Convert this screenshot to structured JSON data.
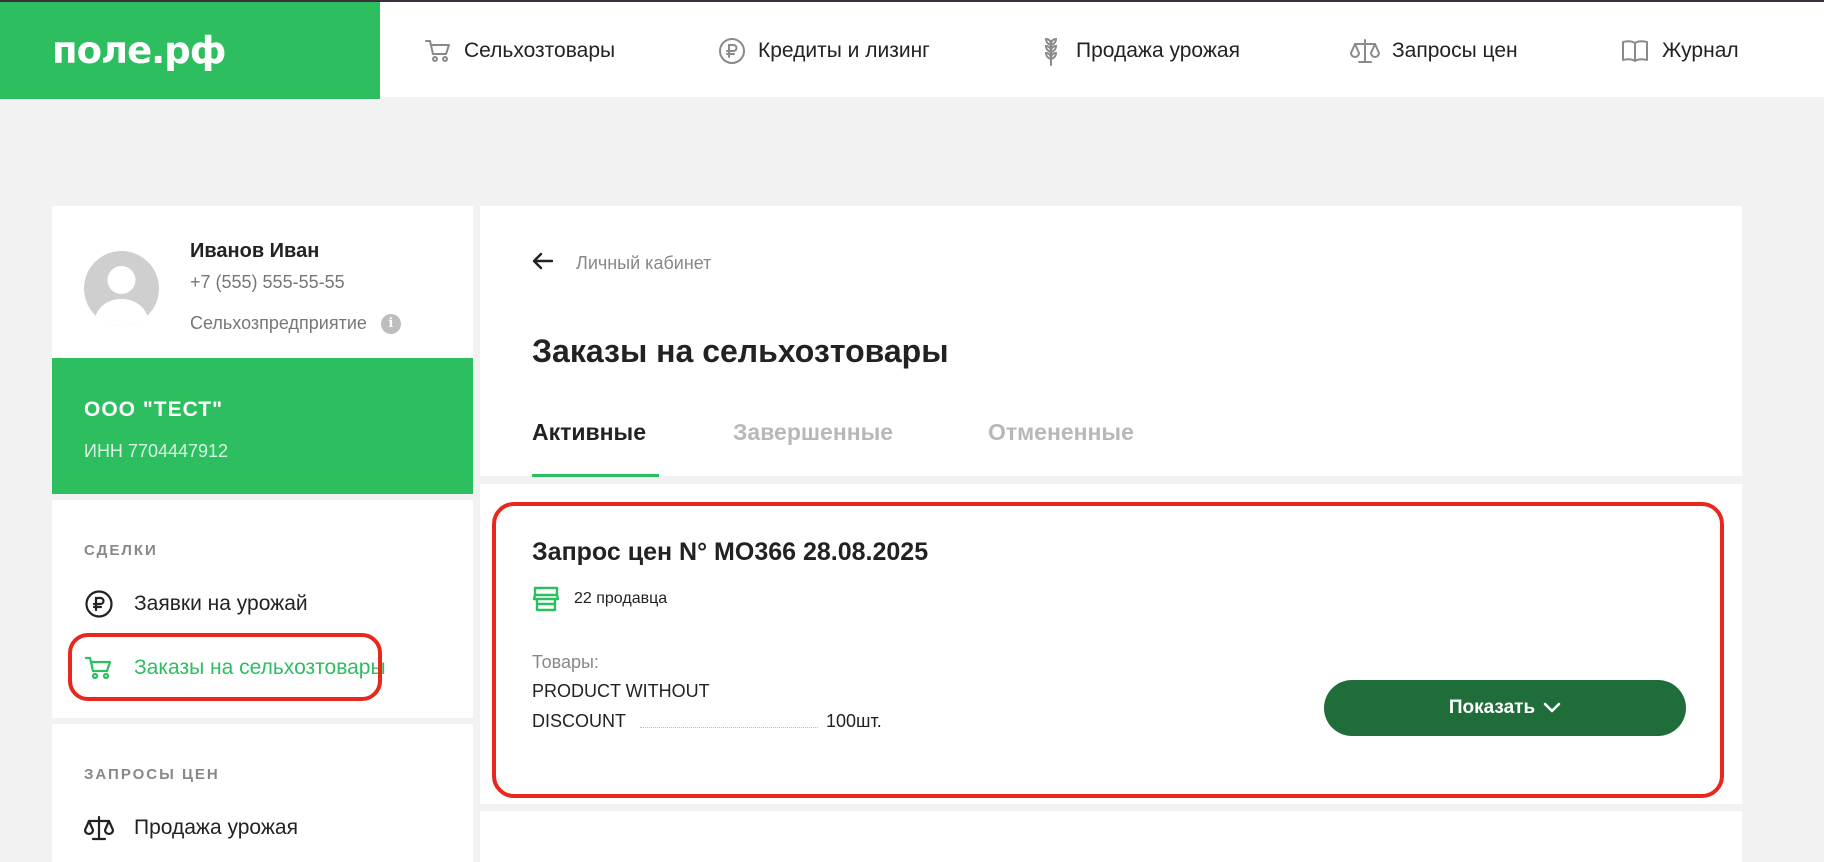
{
  "header": {
    "logo": "поле.рф",
    "nav": [
      {
        "label": "Сельхозтовары",
        "icon": "cart-icon"
      },
      {
        "label": "Кредиты и лизинг",
        "icon": "ruble-icon"
      },
      {
        "label": "Продажа урожая",
        "icon": "wheat-icon"
      },
      {
        "label": "Запросы цен",
        "icon": "scales-icon"
      },
      {
        "label": "Журнал",
        "icon": "book-icon"
      }
    ]
  },
  "profile": {
    "name": "Иванов Иван",
    "phone": "+7 (555) 555-55-55",
    "role": "Сельхозпредприятие",
    "info_icon": "i"
  },
  "company": {
    "name": "ООО \"ТЕСТ\"",
    "inn": "ИНН 7704447912"
  },
  "sidebar": {
    "deals_title": "СДЕЛКИ",
    "deals": [
      {
        "label": "Заявки на урожай",
        "icon": "ruble-circle-icon"
      },
      {
        "label": "Заказы на сельхозтовары",
        "icon": "cart-icon",
        "active": true
      }
    ],
    "prices_title": "ЗАПРОСЫ ЦЕН",
    "prices": [
      {
        "label": "Продажа урожая",
        "icon": "scales-icon"
      }
    ]
  },
  "main": {
    "breadcrumb": "Личный кабинет",
    "title": "Заказы на сельхозтовары",
    "tabs": [
      {
        "label": "Активные",
        "active": true
      },
      {
        "label": "Завершенные",
        "active": false
      },
      {
        "label": "Отмененные",
        "active": false
      }
    ]
  },
  "order": {
    "title": "Запрос цен N° MO366 28.08.2025",
    "sellers": "22 продавца",
    "goods_label": "Товары:",
    "product_line1": "PRODUCT WITHOUT",
    "product_line2": "DISCOUNT",
    "quantity": "100шт.",
    "show_button": "Показать"
  },
  "colors": {
    "brand_green": "#2dbe60",
    "button_green": "#1f6e3a",
    "highlight_red": "#e8281c"
  }
}
